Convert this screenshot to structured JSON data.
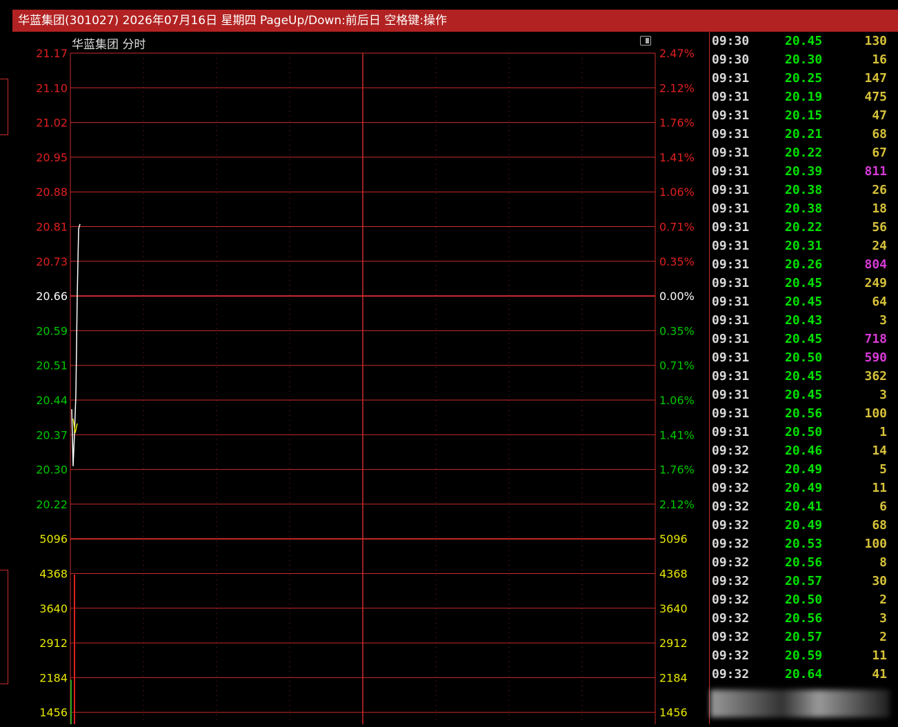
{
  "title_bar": "华蓝集团(301027) 2026年07月16日 星期四 PageUp/Down:前后日 空格键:操作",
  "chart_header": "华蓝集团  分时",
  "colors": {
    "grid": "#cc2b2b",
    "up": "#e02020",
    "down": "#00c800",
    "neutral": "#ffffff",
    "price_line": "#ffffff",
    "avg_line": "#e8e800",
    "volume_bar": "#22aa22"
  },
  "price_axis": [
    {
      "label": "21.17",
      "pct": "2.47%",
      "color": "up"
    },
    {
      "label": "21.10",
      "pct": "2.12%",
      "color": "up"
    },
    {
      "label": "21.02",
      "pct": "1.76%",
      "color": "up"
    },
    {
      "label": "20.95",
      "pct": "1.41%",
      "color": "up"
    },
    {
      "label": "20.88",
      "pct": "1.06%",
      "color": "up"
    },
    {
      "label": "20.81",
      "pct": "0.71%",
      "color": "up"
    },
    {
      "label": "20.73",
      "pct": "0.35%",
      "color": "up"
    },
    {
      "label": "20.66",
      "pct": "0.00%",
      "color": "neutral"
    },
    {
      "label": "20.59",
      "pct": "0.35%",
      "color": "down"
    },
    {
      "label": "20.51",
      "pct": "0.71%",
      "color": "down"
    },
    {
      "label": "20.44",
      "pct": "1.06%",
      "color": "down"
    },
    {
      "label": "20.37",
      "pct": "1.41%",
      "color": "down"
    },
    {
      "label": "20.30",
      "pct": "1.76%",
      "color": "down"
    },
    {
      "label": "20.22",
      "pct": "2.12%",
      "color": "down"
    }
  ],
  "volume_axis": [
    "5096",
    "4368",
    "3640",
    "2912",
    "2184",
    "1456"
  ],
  "chart_data": {
    "type": "line",
    "series": [
      {
        "values": [
          20.42,
          20.3,
          20.37,
          20.45,
          20.66,
          20.8,
          20.81
        ]
      },
      {
        "values": [
          20.4,
          20.37,
          20.39
        ]
      }
    ],
    "ylim": [
      20.22,
      21.17
    ],
    "volume": {
      "values": [
        1400,
        4700
      ]
    }
  },
  "ticks": [
    {
      "time": "09:30",
      "price": "20.45",
      "vol": "130",
      "big": false
    },
    {
      "time": "09:30",
      "price": "20.30",
      "vol": "16",
      "big": false
    },
    {
      "time": "09:31",
      "price": "20.25",
      "vol": "147",
      "big": false
    },
    {
      "time": "09:31",
      "price": "20.19",
      "vol": "475",
      "big": false
    },
    {
      "time": "09:31",
      "price": "20.15",
      "vol": "47",
      "big": false
    },
    {
      "time": "09:31",
      "price": "20.21",
      "vol": "68",
      "big": false
    },
    {
      "time": "09:31",
      "price": "20.22",
      "vol": "67",
      "big": false
    },
    {
      "time": "09:31",
      "price": "20.39",
      "vol": "811",
      "big": true
    },
    {
      "time": "09:31",
      "price": "20.38",
      "vol": "26",
      "big": false
    },
    {
      "time": "09:31",
      "price": "20.38",
      "vol": "18",
      "big": false
    },
    {
      "time": "09:31",
      "price": "20.22",
      "vol": "56",
      "big": false
    },
    {
      "time": "09:31",
      "price": "20.31",
      "vol": "24",
      "big": false
    },
    {
      "time": "09:31",
      "price": "20.26",
      "vol": "804",
      "big": true
    },
    {
      "time": "09:31",
      "price": "20.45",
      "vol": "249",
      "big": false
    },
    {
      "time": "09:31",
      "price": "20.45",
      "vol": "64",
      "big": false
    },
    {
      "time": "09:31",
      "price": "20.43",
      "vol": "3",
      "big": false
    },
    {
      "time": "09:31",
      "price": "20.45",
      "vol": "718",
      "big": true
    },
    {
      "time": "09:31",
      "price": "20.50",
      "vol": "590",
      "big": true
    },
    {
      "time": "09:31",
      "price": "20.45",
      "vol": "362",
      "big": false
    },
    {
      "time": "09:31",
      "price": "20.45",
      "vol": "3",
      "big": false
    },
    {
      "time": "09:31",
      "price": "20.56",
      "vol": "100",
      "big": false
    },
    {
      "time": "09:31",
      "price": "20.50",
      "vol": "1",
      "big": false
    },
    {
      "time": "09:32",
      "price": "20.46",
      "vol": "14",
      "big": false
    },
    {
      "time": "09:32",
      "price": "20.49",
      "vol": "5",
      "big": false
    },
    {
      "time": "09:32",
      "price": "20.49",
      "vol": "11",
      "big": false
    },
    {
      "time": "09:32",
      "price": "20.41",
      "vol": "6",
      "big": false
    },
    {
      "time": "09:32",
      "price": "20.49",
      "vol": "68",
      "big": false
    },
    {
      "time": "09:32",
      "price": "20.53",
      "vol": "100",
      "big": false
    },
    {
      "time": "09:32",
      "price": "20.56",
      "vol": "8",
      "big": false
    },
    {
      "time": "09:32",
      "price": "20.57",
      "vol": "30",
      "big": false
    },
    {
      "time": "09:32",
      "price": "20.50",
      "vol": "2",
      "big": false
    },
    {
      "time": "09:32",
      "price": "20.56",
      "vol": "3",
      "big": false
    },
    {
      "time": "09:32",
      "price": "20.57",
      "vol": "2",
      "big": false
    },
    {
      "time": "09:32",
      "price": "20.59",
      "vol": "11",
      "big": false
    },
    {
      "time": "09:32",
      "price": "20.64",
      "vol": "41",
      "big": false
    }
  ]
}
